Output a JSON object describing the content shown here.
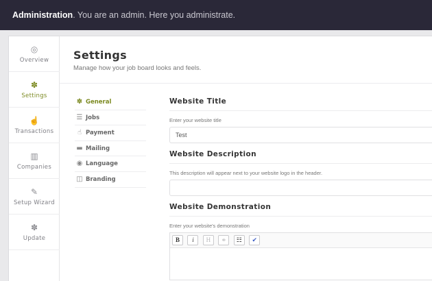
{
  "topbar": {
    "title": "Administration",
    "subtitle": ". You are an admin. Here you administrate."
  },
  "sidebar": {
    "items": [
      {
        "label": "Overview",
        "icon": "◎"
      },
      {
        "label": "Settings",
        "icon": "✽"
      },
      {
        "label": "Transactions",
        "icon": "☝"
      },
      {
        "label": "Companies",
        "icon": "▥"
      },
      {
        "label": "Setup Wizard",
        "icon": "✎"
      },
      {
        "label": "Update",
        "icon": "✽"
      }
    ]
  },
  "page": {
    "title": "Settings",
    "subtitle": "Manage how your job board looks and feels."
  },
  "subnav": {
    "items": [
      {
        "label": "General",
        "icon": "✽"
      },
      {
        "label": "Jobs",
        "icon": "☰"
      },
      {
        "label": "Payment",
        "icon": "☝"
      },
      {
        "label": "Mailing",
        "icon": "▬"
      },
      {
        "label": "Language",
        "icon": "◉"
      },
      {
        "label": "Branding",
        "icon": "◫"
      }
    ]
  },
  "form": {
    "title_section": {
      "heading": "Website Title",
      "label": "Enter your website title",
      "value": "Test"
    },
    "description_section": {
      "heading": "Website Description",
      "label": "This description will appear next to your website logo in the header.",
      "value": ""
    },
    "demo_section": {
      "heading": "Website Demonstration",
      "label": "Enter your website's demonstration"
    },
    "toolbar": {
      "bold": "B",
      "italic": "i",
      "heading": "H",
      "link": "⚭",
      "list": "☷",
      "clean": "✔"
    }
  },
  "colors": {
    "accent": "#7c8a22",
    "topbar": "#2a2838"
  }
}
